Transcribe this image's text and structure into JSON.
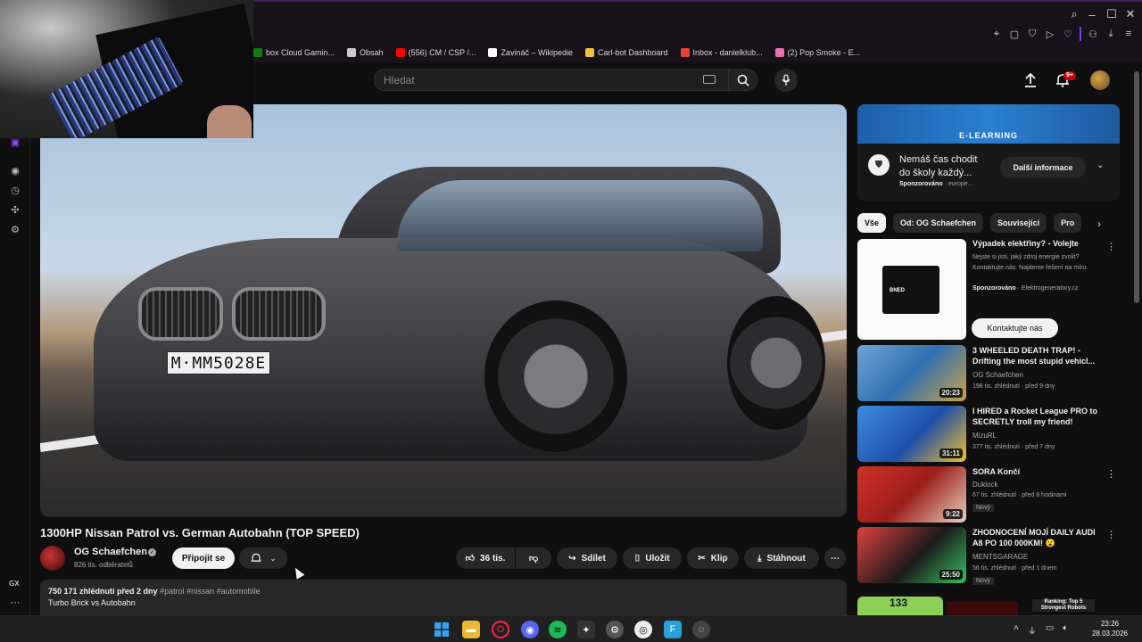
{
  "bookmarks": [
    {
      "label": "box Cloud Gamin...",
      "icon": "xbox-icon",
      "color": "#107c10"
    },
    {
      "label": "Obsah",
      "icon": "doc-icon",
      "color": "#cccccc"
    },
    {
      "label": "(556) CM / CSP /...",
      "icon": "youtube-icon",
      "color": "#ff0000"
    },
    {
      "label": "Zavináč – Wikipedie",
      "icon": "wikipedia-icon",
      "color": "#ffffff"
    },
    {
      "label": "Carl-bot Dashboard",
      "icon": "carlbot-icon",
      "color": "#f0c040"
    },
    {
      "label": "Inbox - danielklub...",
      "icon": "gmail-icon",
      "color": "#ea4335"
    },
    {
      "label": "(2) Pop Smoke - E...",
      "icon": "music-icon",
      "color": "#e86fb0"
    }
  ],
  "header": {
    "search_placeholder": "Hledat",
    "notif_count": "9+"
  },
  "video": {
    "title": "1300HP Nissan Patrol vs. German Autobahn (TOP SPEED)",
    "plate": "M·MM5028E",
    "channel": "OG Schaefchen",
    "subscribers": "826 tis. odběratelů",
    "join_label": "Připojit se",
    "likes": "36 tis.",
    "share_label": "Sdílet",
    "save_label": "Uložit",
    "clip_label": "Klip",
    "download_label": "Stáhnout",
    "views_date": "750 171 zhlédnutí  před 2 dny",
    "tags": "#patrol #nissan #automobile",
    "description": "Turbo Brick vs Autobahn"
  },
  "ad": {
    "banner_text": "E-LEARNING",
    "title": "Nemáš čas chodit do školy každý...",
    "sponsor_label": "Sponzorováno",
    "sponsor_domain": " · europe...",
    "cta": "Další informace"
  },
  "chips": [
    "Vše",
    "Od: OG Schaefchen",
    "Související",
    "Pro"
  ],
  "sponsored": {
    "title": "Výpadek elektřiny? - Volejte",
    "desc": "Nejste si jisti, jaký zdroj energie zvolit? Kontaktujte nás. Najdeme řešení na míru.",
    "sponsor_label": "Sponzorováno",
    "sponsor_domain": " · Elektrogeneratory.cz",
    "cta": "Kontaktujte nás",
    "box_text": "BNED"
  },
  "recommendations": [
    {
      "title": "3 WHEELED DEATH TRAP! - Drifting the most stupid vehicl...",
      "channel": "OG Schaefchen",
      "meta": "198 tis. zhlédnutí · před 9 dny",
      "duration": "20:23",
      "badge": "",
      "thumb_color": "#4a8fd0"
    },
    {
      "title": "I HIRED a Rocket League PRO to SECRETLY troll my friend!",
      "channel": "MizuRL",
      "meta": "377 tis. zhlédnutí · před 7 dny",
      "duration": "31:11",
      "badge": "",
      "thumb_color": "#2a66c8"
    },
    {
      "title": "SORA Končí",
      "channel": "Duklock",
      "meta": "67 tis. zhlédnutí · před 8 hodinami",
      "duration": "9:22",
      "badge": "Nový",
      "thumb_color": "#b0302a"
    },
    {
      "title": "ZHODNOCENÍ MOJÍ DAILY AUDI A8 PO 100 000KM! 😮",
      "channel": "MENTSGARAGE",
      "meta": "56 tis. zhlédnutí · před 1 dnem",
      "duration": "25:50",
      "badge": "Nový",
      "thumb_color": "#cf3d3d"
    }
  ],
  "last_row": {
    "thumb_text": "133",
    "rank_text": "Ranking: Top 5 Strongest Robots"
  },
  "taskbar": {
    "time": "23:26",
    "date": "28.03.2026"
  }
}
